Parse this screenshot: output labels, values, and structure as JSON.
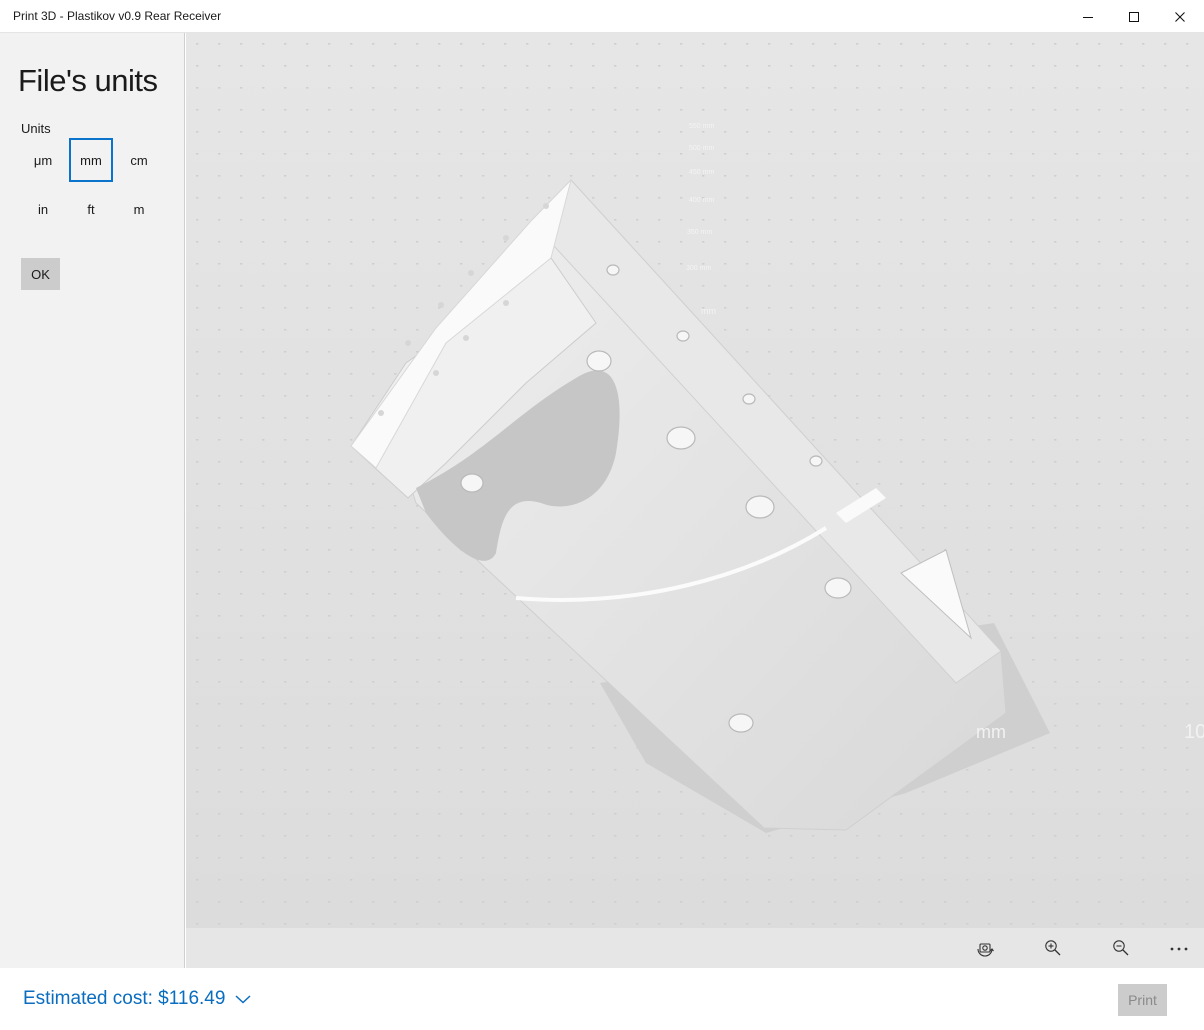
{
  "window": {
    "title": "Print 3D - Plastikov v0.9 Rear Receiver",
    "minimize_icon": "minimize-icon",
    "maximize_icon": "maximize-icon",
    "close_icon": "close-icon"
  },
  "panel": {
    "title": "File's units",
    "units_label": "Units",
    "units": [
      {
        "label": "μm",
        "selected": false
      },
      {
        "label": "mm",
        "selected": true
      },
      {
        "label": "cm",
        "selected": false
      },
      {
        "label": "in",
        "selected": false
      },
      {
        "label": "ft",
        "selected": false
      },
      {
        "label": "m",
        "selected": false
      }
    ],
    "ok_label": "OK"
  },
  "viewport": {
    "scale_labels": [
      "550 mm",
      "500 mm",
      "450 mm",
      "400 mm",
      "350 mm",
      "300 mm",
      "mm"
    ],
    "side_label": "mm",
    "edge_label": "10"
  },
  "view_toolbar": {
    "icons": [
      "camera-rotate-icon",
      "zoom-in-icon",
      "zoom-out-icon",
      "more-icon"
    ]
  },
  "bottom": {
    "estimated_cost": "Estimated cost: $116.49",
    "print_label": "Print"
  },
  "colors": {
    "accent": "#0a74cc",
    "panel_bg": "#f2f2f2",
    "viewport_bg": "#e0e0e0",
    "button_bg": "#cccccc"
  }
}
